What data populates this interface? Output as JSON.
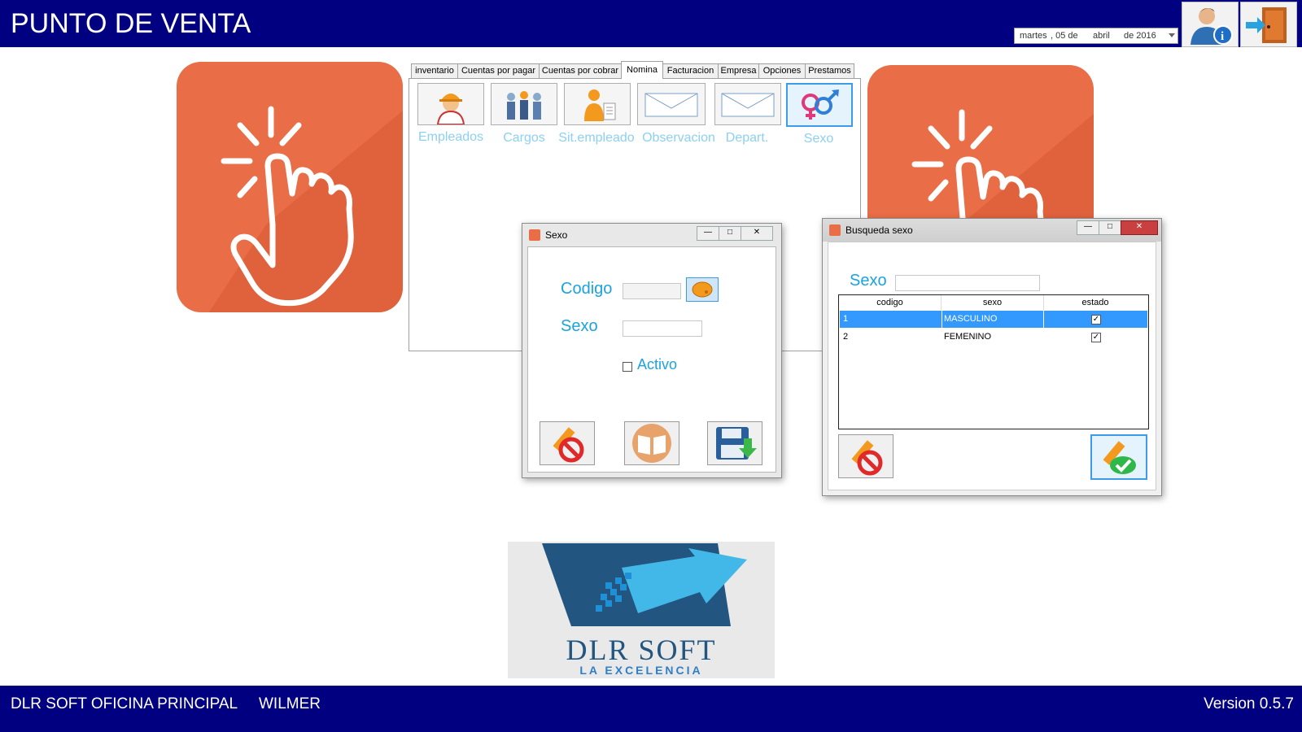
{
  "header": {
    "title": "PUNTO DE VENTA",
    "date": {
      "weekday": "martes",
      "day": ", 05 de",
      "month": "abril",
      "year": "de 2016"
    }
  },
  "tabs": [
    {
      "label": "inventario"
    },
    {
      "label": "Cuentas por pagar"
    },
    {
      "label": "Cuentas por cobrar"
    },
    {
      "label": "Nomina",
      "active": true
    },
    {
      "label": "Facturacion"
    },
    {
      "label": "Empresa"
    },
    {
      "label": "Opciones"
    },
    {
      "label": "Prestamos"
    }
  ],
  "nomina_buttons": [
    {
      "label": "Empleados",
      "icon": "worker-icon"
    },
    {
      "label": "Cargos",
      "icon": "people-icon"
    },
    {
      "label": "Sit.empleado",
      "icon": "person-document-icon"
    },
    {
      "label": "Observacion",
      "icon": "envelope-icon"
    },
    {
      "label": "Depart.",
      "icon": "envelope-icon"
    },
    {
      "label": "Sexo",
      "icon": "gender-icon"
    }
  ],
  "sexo_form": {
    "title": "Sexo",
    "codigo_label": "Codigo",
    "codigo_value": "",
    "sexo_label": "Sexo",
    "sexo_value": "",
    "activo_label": "Activo",
    "activo_checked": false
  },
  "busqueda": {
    "title": "Busqueda sexo",
    "search_label": "Sexo",
    "search_value": "",
    "columns": [
      "codigo",
      "sexo",
      "estado"
    ],
    "rows": [
      {
        "codigo": "1",
        "sexo": "MASCULINO",
        "estado": true,
        "selected": true
      },
      {
        "codigo": "2",
        "sexo": "FEMENINO",
        "estado": true,
        "selected": false
      }
    ]
  },
  "logo": {
    "name": "DLR SOFT",
    "tagline": "LA EXCELENCIA"
  },
  "footer": {
    "office": "DLR SOFT OFICINA PRINCIPAL",
    "user": "WILMER",
    "version": "Version 0.5.7"
  },
  "colors": {
    "header": "#010080",
    "tile": "#e96d46",
    "accent": "#1aa3e0",
    "selection": "#3399ff"
  }
}
